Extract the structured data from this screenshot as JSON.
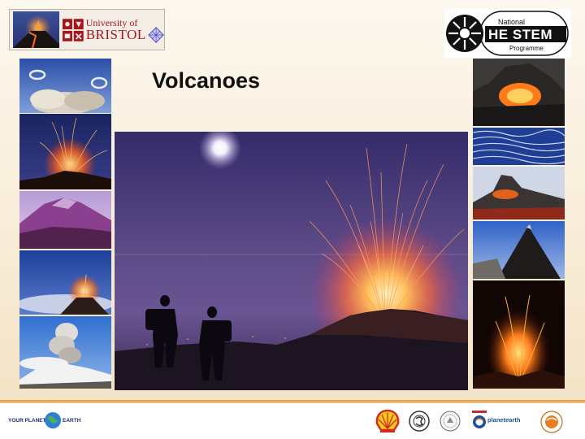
{
  "slide": {
    "title": "Volcanoes"
  },
  "logos": {
    "university": {
      "line1": "University of",
      "line2": "BRISTOL"
    },
    "hestem": {
      "line1": "National",
      "line2": "HE STEM",
      "line3": "Programme"
    }
  },
  "footer": {
    "your_planet_left": "YOUR PLANET",
    "your_planet_right": "EARTH",
    "planet_earth": "planetearth"
  },
  "colors": {
    "background_top": "#fdf8ef",
    "background_bottom": "#f3e2c3",
    "accent_orange": "#e79a43",
    "bristol_red": "#a7161c"
  },
  "images": [
    {
      "name": "steam-rings-photo",
      "subject": "volcanic steam rings"
    },
    {
      "name": "strombolian-eruption-photo",
      "subject": "night lava fountain"
    },
    {
      "name": "snowy-volcano-photo",
      "subject": "purple volcano peak"
    },
    {
      "name": "sea-of-clouds-eruption-photo",
      "subject": "eruption above clouds"
    },
    {
      "name": "ash-plume-photo",
      "subject": "ash plume over snowy mountain"
    },
    {
      "name": "main-eruption-photo",
      "subject": "two figures watching eruption at night"
    },
    {
      "name": "lava-vent-photo",
      "subject": "glowing lava vent"
    },
    {
      "name": "pahoehoe-lava-photo",
      "subject": "ropy lava flow"
    },
    {
      "name": "lava-cone-photo",
      "subject": "lava cone with glow"
    },
    {
      "name": "cinder-cone-photo",
      "subject": "dark cinder cone"
    },
    {
      "name": "lava-fountain-photo",
      "subject": "orange lava fountain"
    }
  ]
}
